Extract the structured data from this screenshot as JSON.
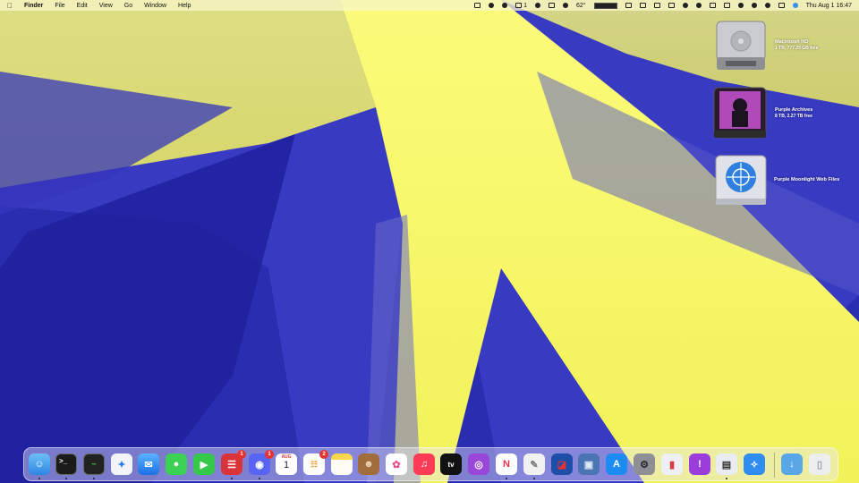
{
  "menubar": {
    "apple": "",
    "app_name": "Finder",
    "menus": [
      "File",
      "Edit",
      "View",
      "Go",
      "Window",
      "Help"
    ],
    "status_count": "1",
    "temperature": "62°",
    "datetime": "Thu Aug 1  16:47"
  },
  "desktop": {
    "icons": [
      {
        "name": "Macintosh HD",
        "detail": "1 TB, 777.29 GB free"
      },
      {
        "name": "Purple Archives",
        "detail": "8 TB, 2.27 TB free"
      },
      {
        "name": "Purple Moonlight Web Files",
        "detail": ""
      }
    ]
  },
  "dock": {
    "calendar_month": "AUG",
    "calendar_day": "1",
    "badges": {
      "app_a": "1",
      "discord": "1",
      "reminders": "2"
    },
    "apps": [
      "finder-icon",
      "terminal-icon",
      "activity-monitor-icon",
      "safari-icon",
      "mail-icon",
      "messages-icon",
      "facetime-icon",
      "chat-app-icon",
      "discord-icon",
      "calendar-icon",
      "reminders-icon",
      "notes-icon",
      "contacts-icon",
      "photos-icon",
      "music-icon",
      "tv-icon",
      "podcasts-icon",
      "news-icon",
      "script-editor-icon",
      "remote-desktop-icon",
      "virtualbox-icon",
      "app-store-icon",
      "system-settings-icon",
      "iphone-mirroring-icon",
      "feedback-icon",
      "preview-icon",
      "safari-web-app-icon",
      "downloads-folder-icon",
      "trash-icon"
    ]
  },
  "colors": {
    "wall_blue": "#2a2cae",
    "wall_yellow": "#f4f46c",
    "badge_red": "#e53232"
  }
}
